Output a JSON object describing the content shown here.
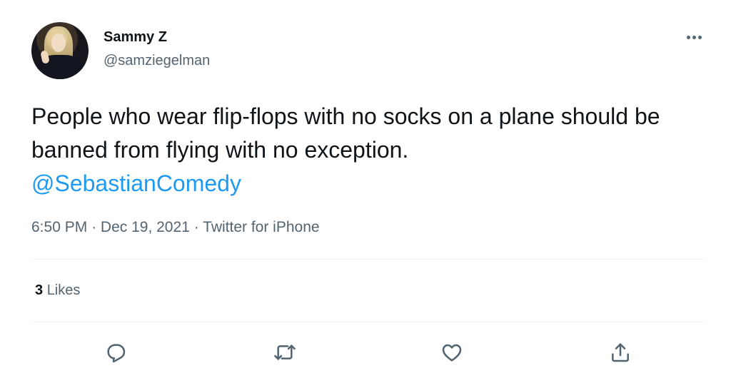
{
  "user": {
    "display_name": "Sammy Z",
    "handle": "@samziegelman"
  },
  "tweet": {
    "text": "People who wear flip-flops with no socks on a plane should be banned from flying with no exception.",
    "mention": "@SebastianComedy",
    "time": "6:50 PM",
    "date": "Dec 19, 2021",
    "source": "Twitter for iPhone",
    "separator": "·"
  },
  "stats": {
    "likes_count": "3",
    "likes_label": "Likes"
  },
  "icons": {
    "more": "more-icon",
    "reply": "reply-icon",
    "retweet": "retweet-icon",
    "like": "heart-icon",
    "share": "share-icon"
  },
  "colors": {
    "text": "#0f1419",
    "secondary": "#536471",
    "link": "#1d9bf0",
    "divider": "#eff3f4"
  }
}
